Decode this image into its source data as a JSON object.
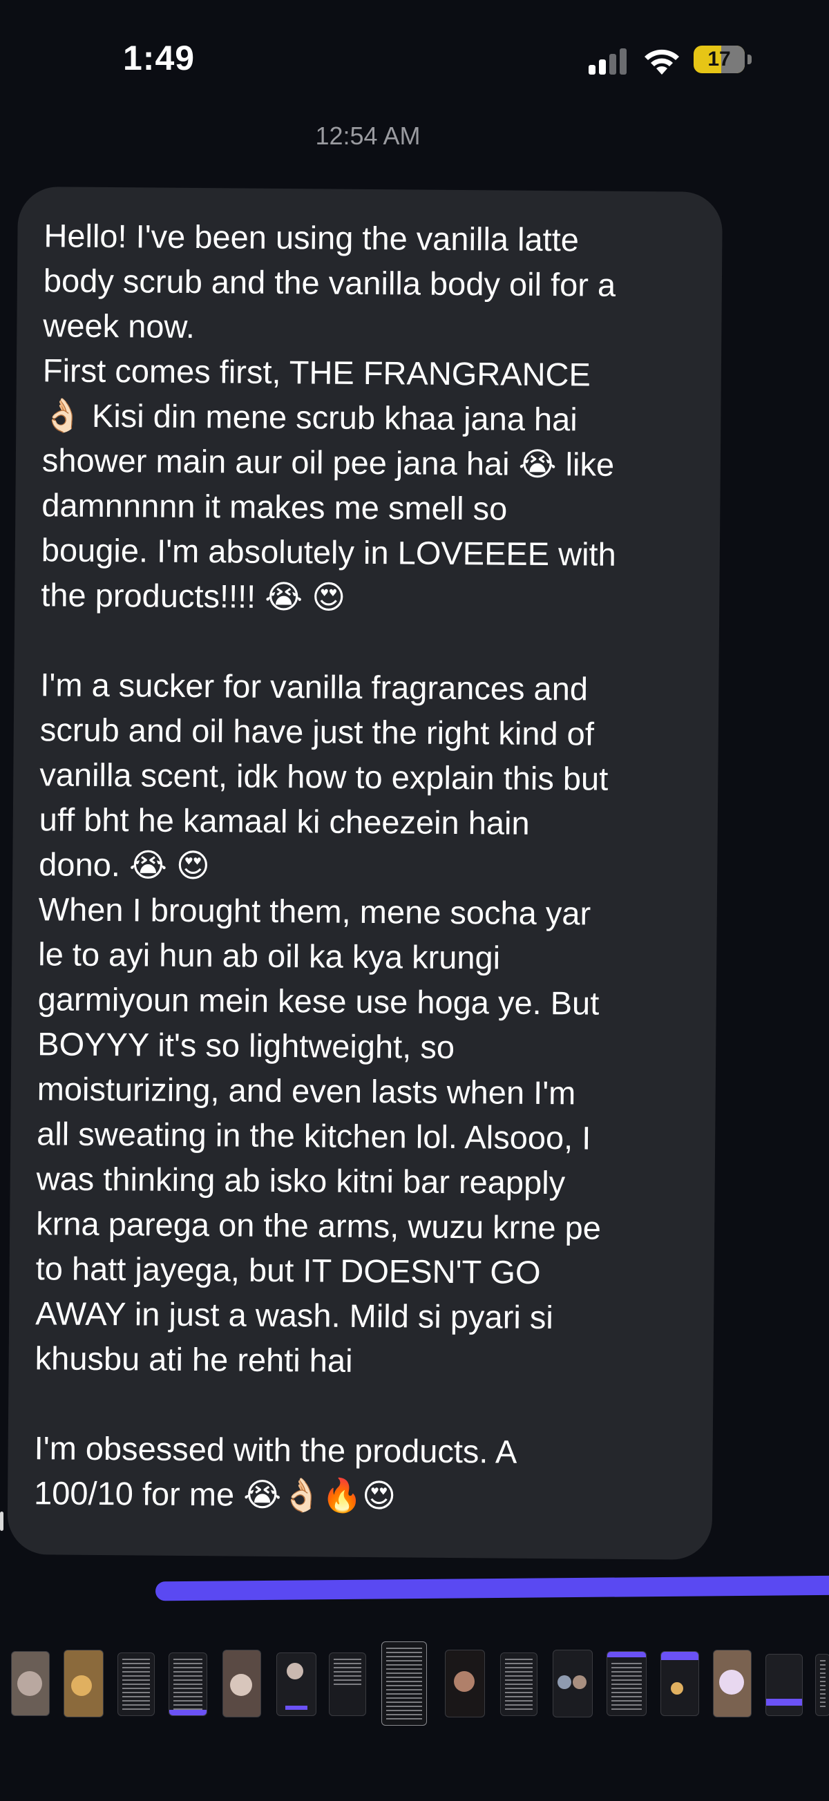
{
  "status_bar": {
    "time": "1:49",
    "battery_level": "17",
    "battery_percent": 17,
    "battery_color": "#e6c516",
    "signal_bars_active": 2,
    "signal_bars_total": 4,
    "icons": [
      "cellular-signal-icon",
      "wifi-icon",
      "battery-icon"
    ]
  },
  "conversation": {
    "timestamp": "12:54 AM",
    "message": "Hello! I've been using the vanilla latte\nbody scrub and the vanilla body oil for a\nweek now.\nFirst comes first, THE FRANGRANCE\n👌🏻 Kisi din mene scrub khaa jana hai\nshower main aur oil pee jana hai 😭 like\ndamnnnnn it makes me smell so\nbougie. I'm absolutely in LOVEEEE with\nthe products!!!! 😭 😍\n\nI'm a sucker for vanilla fragrances and\nscrub and oil have just the right kind of\nvanilla scent, idk how to explain this but\nuff bht he kamaal ki cheezein hain\ndono. 😭 😍\nWhen I brought them, mene socha yar\nle to ayi hun ab oil ka kya krungi\ngarmiyoun mein kese use hoga ye. But\nBOYYY it's so lightweight, so\nmoisturizing, and even lasts when I'm\nall sweating in the kitchen lol. Alsooo, I\nwas thinking ab isko kitni bar reapply\nkrna parega on the arms, wuzu krne pe\nto hatt jayega, but IT DOESN'T GO\nAWAY in just a wash. Mild si pyari si\nkhusbu ati he rehti hai\n\nI'm obsessed with the products. A\n100/10 for me 😭👌🏻🔥😍",
    "bubble_color": "#25272c",
    "accent_color": "#5a49f2"
  },
  "thumbnail_strip": {
    "count": 17,
    "selected_index": 7
  }
}
